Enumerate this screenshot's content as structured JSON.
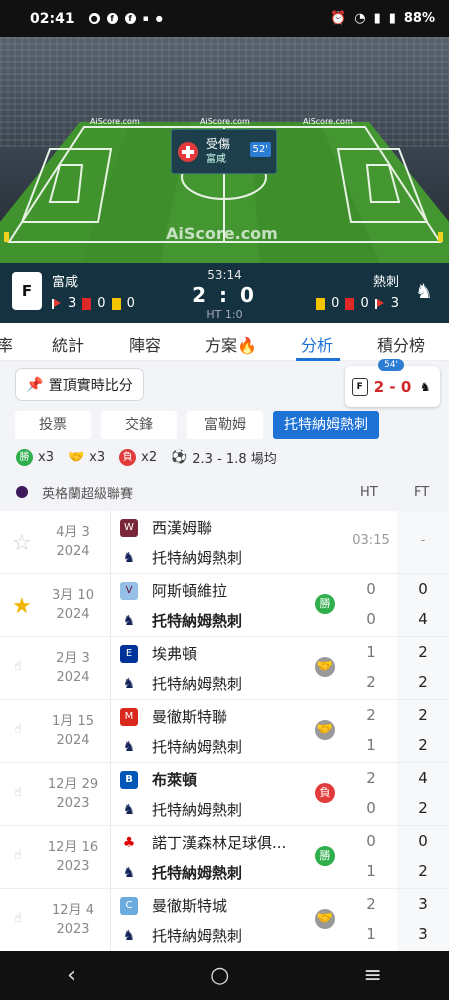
{
  "status": {
    "time": "02:41",
    "battery": "88%"
  },
  "event": {
    "title": "受傷",
    "team": "富咸",
    "minute": "52'"
  },
  "watermarks": {
    "small": "AiScore.com",
    "pitch": "AiScore.com"
  },
  "match": {
    "clock": "53:14",
    "score": "2 : 0",
    "half_time": "HT 1:0",
    "home": {
      "name": "富咸",
      "corners": "3",
      "reds": "0",
      "yellows": "0"
    },
    "away": {
      "name": "熱刺",
      "yellows": "0",
      "reds": "0",
      "corners": "3"
    }
  },
  "tabs": [
    "率",
    "統計",
    "陣容",
    "方案🔥",
    "分析",
    "積分榜"
  ],
  "pin_button": "置頂實時比分",
  "mini_score": {
    "minute": "54'",
    "score": "2 - 0"
  },
  "filters": [
    "投票",
    "交鋒",
    "富勒姆",
    "托特納姆熱刺"
  ],
  "summary": {
    "wins": "x3",
    "draws": "x3",
    "losses": "x2",
    "goals": "2.3 - 1.8 場均",
    "win_label": "勝",
    "loss_label": "負"
  },
  "league": {
    "name": "英格蘭超級聯賽",
    "ht": "HT",
    "ft": "FT"
  },
  "rows": [
    {
      "date1": "4月 3",
      "date2": "2024",
      "home": "西漢姆聯",
      "away": "托特納姆熱刺",
      "time": "03:15",
      "ft": "-"
    },
    {
      "date1": "3月 10",
      "date2": "2024",
      "home": "阿斯頓維拉",
      "away": "托特納姆熱刺",
      "result": "勝",
      "ht1": "0",
      "ht2": "0",
      "ft1": "0",
      "ft2": "4"
    },
    {
      "date1": "2月 3",
      "date2": "2024",
      "home": "埃弗頓",
      "away": "托特納姆熱刺",
      "ht1": "1",
      "ht2": "2",
      "ft1": "2",
      "ft2": "2"
    },
    {
      "date1": "1月 15",
      "date2": "2024",
      "home": "曼徹斯特聯",
      "away": "托特納姆熱刺",
      "ht1": "2",
      "ht2": "1",
      "ft1": "2",
      "ft2": "2"
    },
    {
      "date1": "12月 29",
      "date2": "2023",
      "home": "布萊頓",
      "away": "托特納姆熱刺",
      "result": "負",
      "ht1": "2",
      "ht2": "0",
      "ft1": "4",
      "ft2": "2"
    },
    {
      "date1": "12月 16",
      "date2": "2023",
      "home": "諾丁漢森林足球俱...",
      "away": "托特納姆熱刺",
      "result": "勝",
      "ht1": "0",
      "ht2": "1",
      "ft1": "0",
      "ft2": "2"
    },
    {
      "date1": "12月 4",
      "date2": "2023",
      "home": "曼徹斯特城",
      "away": "托特納姆熱刺",
      "ht1": "2",
      "ht2": "1",
      "ft1": "3",
      "ft2": "3"
    }
  ],
  "colors": {
    "accent": "#1e72d6",
    "win": "#2fae4c",
    "loss": "#e23b3b",
    "scorebar": "#14323f"
  }
}
